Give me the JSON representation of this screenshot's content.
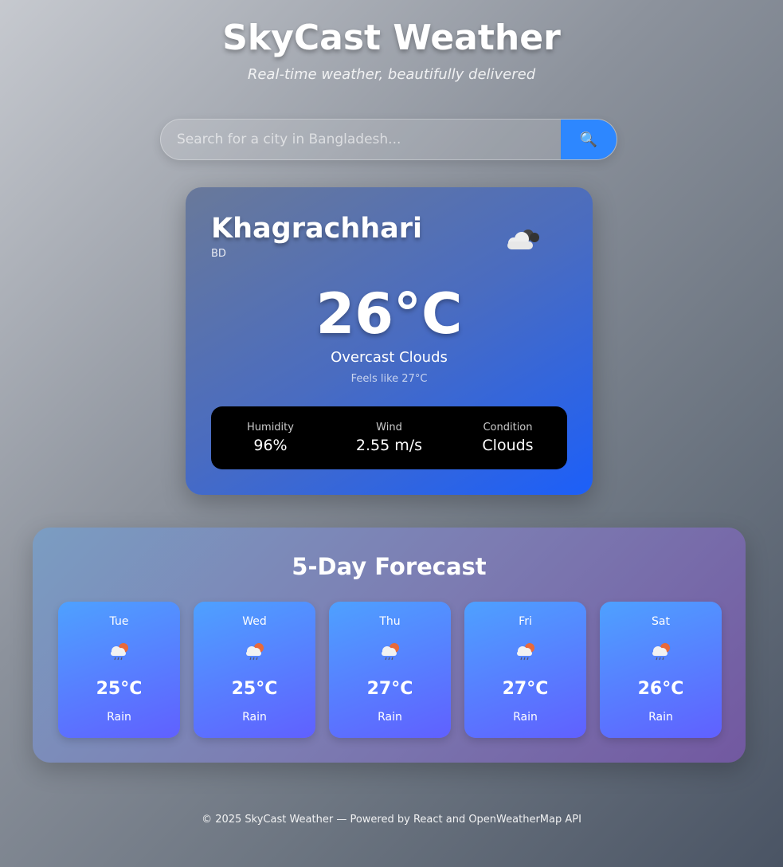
{
  "header": {
    "title": "SkyCast Weather",
    "subtitle": "Real-time weather, beautifully delivered"
  },
  "search": {
    "placeholder": "Search for a city in Bangladesh...",
    "value": "",
    "button_icon": "search-icon"
  },
  "current": {
    "city": "Khagrachhari",
    "country": "BD",
    "icon": "overcast-clouds-icon",
    "temperature": "26°C",
    "description": "Overcast Clouds",
    "feels_like": "Feels like 27°C",
    "stats": [
      {
        "label": "Humidity",
        "value": "96%"
      },
      {
        "label": "Wind",
        "value": "2.55 m/s"
      },
      {
        "label": "Condition",
        "value": "Clouds"
      }
    ]
  },
  "forecast": {
    "title": "5-Day Forecast",
    "days": [
      {
        "day": "Tue",
        "icon": "rain-sun-icon",
        "temp": "25°C",
        "condition": "Rain"
      },
      {
        "day": "Wed",
        "icon": "rain-sun-icon",
        "temp": "25°C",
        "condition": "Rain"
      },
      {
        "day": "Thu",
        "icon": "rain-sun-icon",
        "temp": "27°C",
        "condition": "Rain"
      },
      {
        "day": "Fri",
        "icon": "rain-sun-icon",
        "temp": "27°C",
        "condition": "Rain"
      },
      {
        "day": "Sat",
        "icon": "rain-sun-icon",
        "temp": "26°C",
        "condition": "Rain"
      }
    ]
  },
  "footer": {
    "text": "© 2025 SkyCast Weather — Powered by React and OpenWeatherMap API"
  },
  "colors": {
    "search_button": "#2d87ff",
    "stats_bg": "#000000",
    "card_accent": "#1c5ff9"
  }
}
